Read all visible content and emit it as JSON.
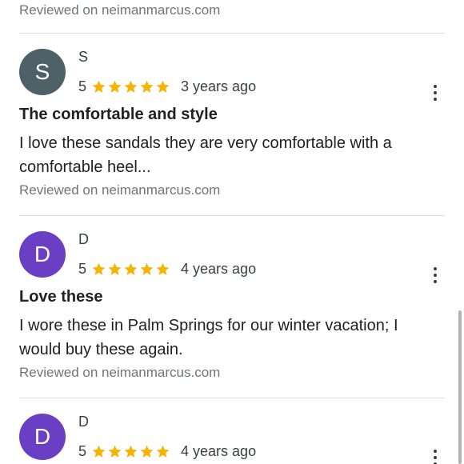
{
  "colors": {
    "star": "#f5b400",
    "avatar_s": "#4e6068",
    "avatar_d": "#6a3fc4"
  },
  "top": {
    "source": "Reviewed on neimanmarcus.com"
  },
  "reviews": [
    {
      "avatar_letter": "S",
      "author": "S",
      "rating": "5",
      "stars": 5,
      "time": "3 years ago",
      "title": "The comfortable and style",
      "text": "I love these sandals they are very comfortable with a comfortable heel...",
      "source": "Reviewed on neimanmarcus.com",
      "more_icon": "more-vert-icon"
    },
    {
      "avatar_letter": "D",
      "author": "D",
      "rating": "5",
      "stars": 5,
      "time": "4 years ago",
      "title": "Love these",
      "text": "I wore these in Palm Springs for our winter vacation; I would buy these again.",
      "source": "Reviewed on neimanmarcus.com",
      "more_icon": "more-vert-icon"
    },
    {
      "avatar_letter": "D",
      "author": "D",
      "rating": "5",
      "stars": 5,
      "time": "4 years ago",
      "more_icon": "more-vert-icon"
    }
  ]
}
